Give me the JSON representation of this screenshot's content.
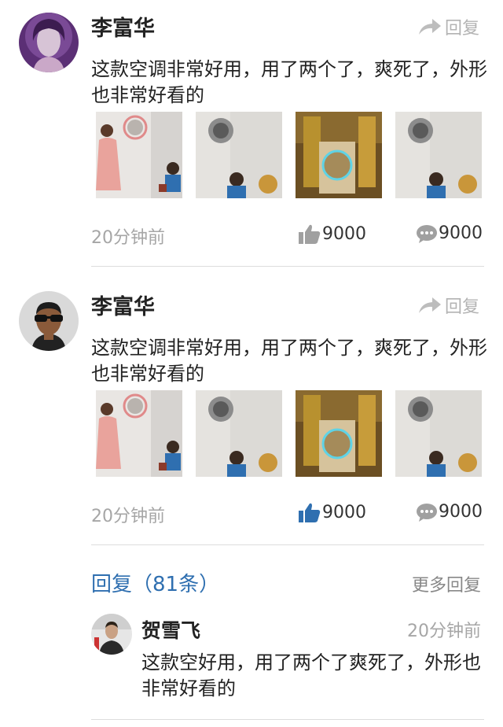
{
  "posts": [
    {
      "author": "李富华",
      "reply_label": "回复",
      "content": "这款空调非常好用，用了两个了，爽死了，外形也非常好看的",
      "time": "20分钟前",
      "likes": "9000",
      "comments": "9000",
      "liked": false
    },
    {
      "author": "李富华",
      "reply_label": "回复",
      "content": "这款空调非常好用，用了两个了，爽死了，外形也非常好看的",
      "time": "20分钟前",
      "likes": "9000",
      "comments": "9000",
      "liked": true
    }
  ],
  "replies_section": {
    "title": "回复（81条）",
    "more_label": "更多回复"
  },
  "reply": {
    "author": "贺雪飞",
    "time": "20分钟前",
    "content": "这款空好用，用了两个了爽死了，外形也非常好看的"
  },
  "colors": {
    "like_active": "#2f6fb0",
    "icon_inactive": "#a0a0a0",
    "link_blue": "#2f6fb0"
  }
}
